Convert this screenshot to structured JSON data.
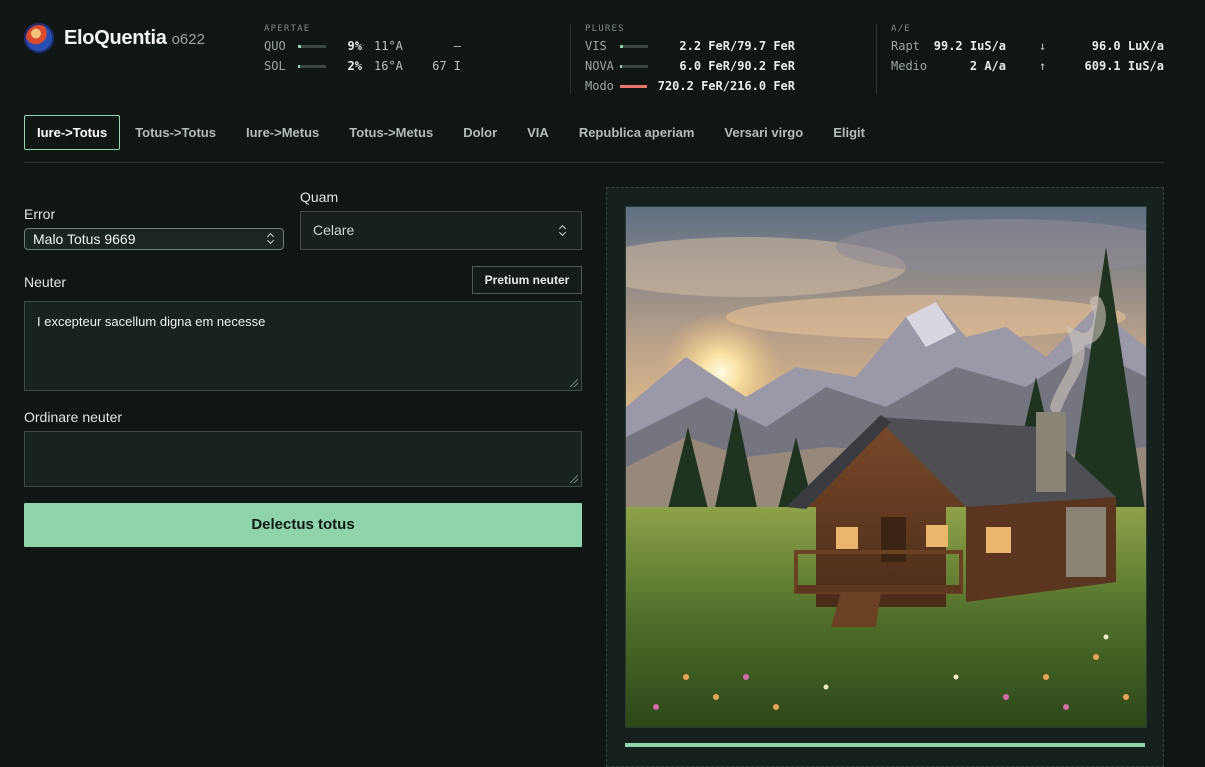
{
  "app": {
    "name": "EloQuentia",
    "version": "o622"
  },
  "stats": {
    "apertae": {
      "title": "APERTAE",
      "rows": [
        {
          "label": "QUO",
          "percent": "9%",
          "fill": 0.09,
          "temp": "11°A",
          "extra": "–"
        },
        {
          "label": "SOL",
          "percent": "2%",
          "fill": 0.02,
          "temp": "16°A",
          "extra": "67 I"
        }
      ]
    },
    "plures": {
      "title": "PLURES",
      "rows": [
        {
          "label": "VIS",
          "value": "2.2 FeR/79.7 FeR",
          "fill": 0.1
        },
        {
          "label": "NOVA",
          "value": "6.0 FeR/90.2 FeR",
          "fill": 0.05
        },
        {
          "label": "Modo",
          "value": "720.2 FeR/216.0 FeR",
          "fill": 1.0
        }
      ]
    },
    "ae": {
      "title": "A/E",
      "rows": [
        {
          "label": "Rapt",
          "value": "99.2 IuS/a",
          "arrow": "↓",
          "value2": "96.0 LuX/a"
        },
        {
          "label": "Medio",
          "value": "2 A/a",
          "arrow": "↑",
          "value2": "609.1 IuS/a"
        }
      ]
    }
  },
  "tabs": [
    {
      "label": "Iure->Totus",
      "active": true
    },
    {
      "label": "Totus->Totus"
    },
    {
      "label": "Iure->Metus"
    },
    {
      "label": "Totus->Metus"
    },
    {
      "label": "Dolor"
    },
    {
      "label": "VIA"
    },
    {
      "label": "Republica aperiam"
    },
    {
      "label": "Versari virgo"
    },
    {
      "label": "Eligit"
    }
  ],
  "form": {
    "error_label": "Error",
    "error_value": "Malo Totus 9669",
    "quam_label": "Quam",
    "quam_value": "Celare",
    "neuter_label": "Neuter",
    "pretium_button": "Pretium neuter",
    "neuter_value": "I excepteur sacellum digna em necesse",
    "ordinare_label": "Ordinare neuter",
    "ordinare_value": "",
    "submit_label": "Delectus totus"
  },
  "colors": {
    "accent": "#8fd4ac",
    "background": "#101614",
    "alert": "#e9746e"
  }
}
